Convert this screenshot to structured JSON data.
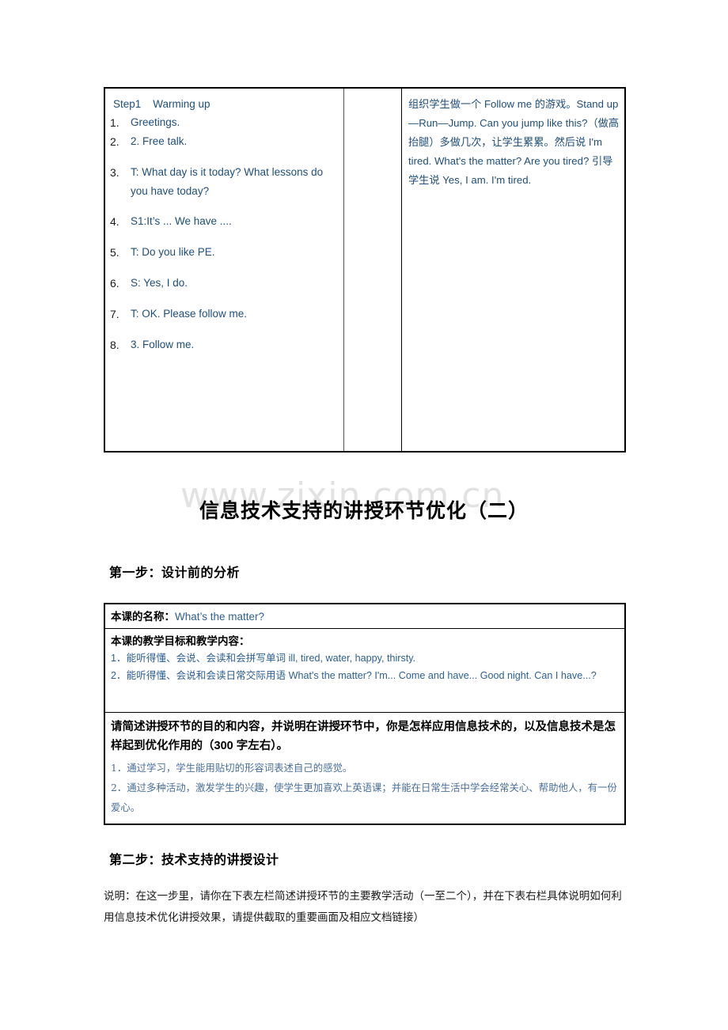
{
  "top_table": {
    "step_heading": "Step1    Warming up",
    "items": [
      {
        "num": "1.",
        "text": "Greetings."
      },
      {
        "num": "2.",
        "text": "2. Free talk."
      },
      {
        "num": "3.",
        "text": "T: What day is it today? What lessons do you have today?"
      },
      {
        "num": "4.",
        "text": "S1:It’s ... We have ...."
      },
      {
        "num": "5.",
        "text": "T: Do you like PE."
      },
      {
        "num": "6.",
        "text": "S: Yes, I do."
      },
      {
        "num": "7.",
        "text": "T: OK. Please follow me."
      },
      {
        "num": "8.",
        "text": "3. Follow me."
      }
    ],
    "middle_column": "",
    "right_column": "组织学生做一个 Follow me 的游戏。Stand up—Run—Jump. Can you jump like this?（做高抬腿）多做几次，让学生累累。然后说 I'm tired. What's the matter? Are you tired? 引导学生说 Yes, I am. I'm tired."
  },
  "watermark": "www.zixin.com.cn",
  "document_title": "信息技术支持的讲授环节优化（二）",
  "sections": [
    {
      "heading": "第一步：设计前的分析"
    },
    {
      "heading": "第二步：技术支持的讲授设计"
    }
  ],
  "analysis_box": {
    "lesson_name_label": "本课的名称：",
    "lesson_name_value": "What’s the matter?",
    "objectives_label": "本课的教学目标和教学内容：",
    "objectives_lines": [
      "1．能听得懂、会说、会读和会拼写单词 ill, tired, water, happy, thirsty.",
      "2．能听得懂、会说和会读日常交际用语 What's the matter? I'm... Come and have... Good night. Can I have...?"
    ],
    "question_label": "请简述讲授环节的目的和内容，并说明在讲授环节中，你是怎样应用信息技术的，以及信息技术是怎样起到优化作用的（300 字左右）。",
    "answer_lines": [
      "1．通过学习，学生能用贴切的形容词表述自己的感觉。",
      "2．通过多种活动，激发学生的兴趣，使学生更加喜欢上英语课；并能在日常生活中学会经常关心、帮助他人，有一份爱心。"
    ]
  },
  "note_paragraph": "说明：在这一步里，请你在下表左栏简述讲授环节的主要教学活动（一至二个），并在下表右栏具体说明如何利用信息技术优化讲授效果，请提供截取的重要画面及相应文档链接）",
  "colors": {
    "body_blue": "#1f4e79",
    "accent_blue": "#2e6094",
    "watermark_gray": "#e2e2e2",
    "border_black": "#000000"
  }
}
